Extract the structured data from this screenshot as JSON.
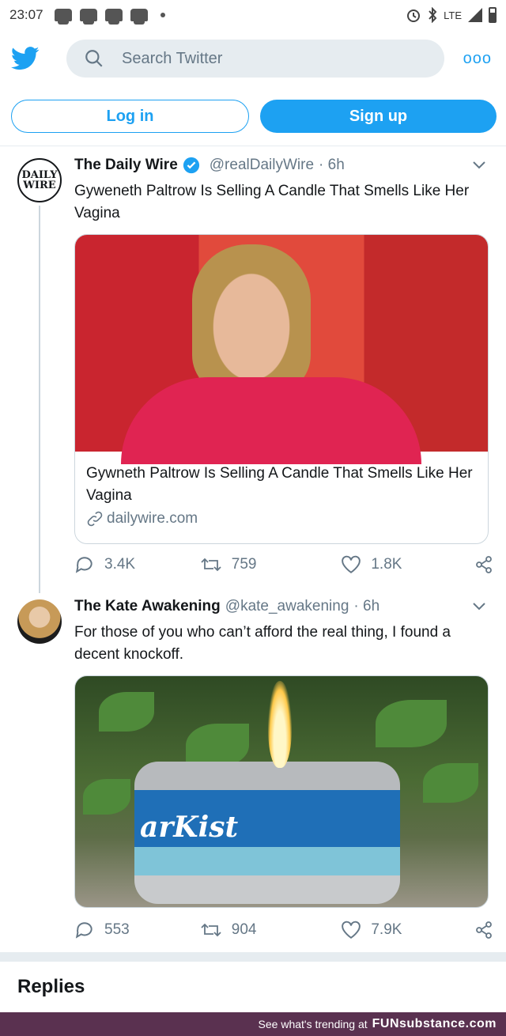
{
  "status": {
    "time": "23:07",
    "network": "LTE"
  },
  "header": {
    "search_placeholder": "Search Twitter",
    "more": "ooo"
  },
  "auth": {
    "login": "Log in",
    "signup": "Sign up"
  },
  "tweets": [
    {
      "avatar_text_1": "DAILY",
      "avatar_text_2": "WIRE",
      "name": "The Daily Wire",
      "handle": "@realDailyWire",
      "time": "· 6h",
      "text": "Gyweneth Paltrow Is Selling A Candle That Smells Like Her Vagina",
      "card_title": "Gywneth Paltrow Is Selling A Candle That Smells Like Her Vagina",
      "card_domain": "dailywire.com",
      "replies": "3.4K",
      "retweets": "759",
      "likes": "1.8K"
    },
    {
      "name": "The Kate Awakening",
      "handle": "@kate_awakening",
      "time": "· 6h",
      "text": "For those of you who can’t afford the real thing, I found a decent knockoff.",
      "image_label": "arKist",
      "replies": "553",
      "retweets": "904",
      "likes": "7.9K"
    }
  ],
  "replies_heading": "Replies",
  "footer": {
    "text": "See what's trending at",
    "brand": "FUNsubstance.com"
  },
  "colors": {
    "accent": "#1da1f2",
    "muted": "#657786",
    "footer_bg": "#5a3150"
  }
}
